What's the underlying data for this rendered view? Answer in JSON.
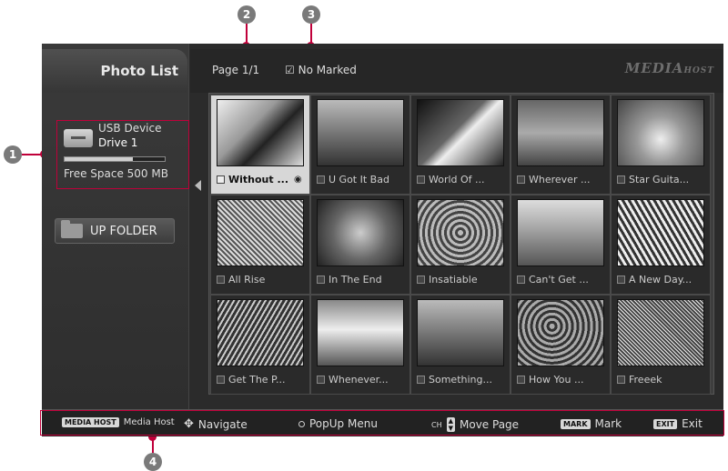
{
  "callouts": [
    "1",
    "2",
    "3",
    "4"
  ],
  "sidebar": {
    "title": "Photo List",
    "device_label": "USB Device",
    "drive_label": "Drive 1",
    "free_space": "Free Space 500 MB",
    "space_used_fraction": 0.68,
    "up_folder": "UP FOLDER"
  },
  "topbar": {
    "page": "Page 1/1",
    "marked": "No Marked",
    "brand": "MEDIA",
    "brand_sub": "HOST"
  },
  "photos": [
    {
      "label": "Without ...",
      "selected": true
    },
    {
      "label": "U Got It Bad",
      "selected": false
    },
    {
      "label": "World Of ...",
      "selected": false
    },
    {
      "label": "Wherever ...",
      "selected": false
    },
    {
      "label": "Star Guita...",
      "selected": false
    },
    {
      "label": "All Rise",
      "selected": false
    },
    {
      "label": "In The End",
      "selected": false
    },
    {
      "label": "Insatiable",
      "selected": false
    },
    {
      "label": "Can't Get ...",
      "selected": false
    },
    {
      "label": "A New Day...",
      "selected": false
    },
    {
      "label": "Get The P...",
      "selected": false
    },
    {
      "label": "Whenever...",
      "selected": false
    },
    {
      "label": "Something...",
      "selected": false
    },
    {
      "label": "How You ...",
      "selected": false
    },
    {
      "label": "Freeek",
      "selected": false
    }
  ],
  "bottombar": {
    "media_host_key": "MEDIA HOST",
    "media_host_label": "Media Host",
    "navigate": "Navigate",
    "popup": "PopUp Menu",
    "ch_key": "CH",
    "move_page": "Move Page",
    "mark_key": "MARK",
    "mark": "Mark",
    "exit_key": "EXIT",
    "exit": "Exit"
  }
}
